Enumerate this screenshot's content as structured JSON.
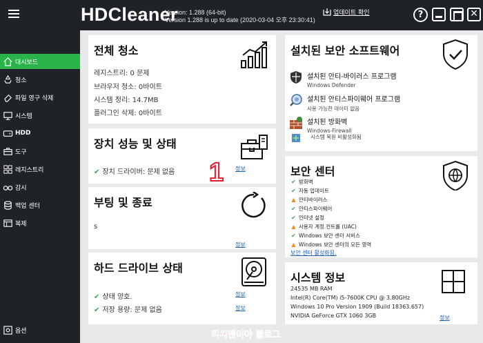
{
  "header": {
    "brand": "HDCleaner",
    "version_line1": "Version: 1.288 (64-bit)",
    "version_line2": "Version 1.288 is up to date (2020-03-04 오후 23:30:41)",
    "update_label": "업데이트 확인"
  },
  "sidebar": {
    "items": [
      {
        "label": "대시보드",
        "icon": "home-icon"
      },
      {
        "label": "청소",
        "icon": "recycle-icon"
      },
      {
        "label": "파일 영구 삭제",
        "icon": "eraser-icon"
      },
      {
        "label": "시스템",
        "icon": "monitor-icon"
      },
      {
        "label": "HDD",
        "icon": "hdd-icon"
      },
      {
        "label": "도구",
        "icon": "toolbox-icon"
      },
      {
        "label": "레지스트리",
        "icon": "registry-icon"
      },
      {
        "label": "감시",
        "icon": "glasses-icon"
      },
      {
        "label": "백업 센터",
        "icon": "database-icon"
      },
      {
        "label": "복제",
        "icon": "clone-icon"
      }
    ],
    "settings_label": "옵션"
  },
  "panels": {
    "clean": {
      "title": "전체 청소",
      "lines": [
        "레지스트리: 0 문제",
        "브라우저 청소: 0바이트",
        "시스템 정리: 14.7MB",
        "플러그인 삭제: 0바이트"
      ]
    },
    "device": {
      "title": "장치 성능 및 상태",
      "line": "장치 드라이버: 문제 없음",
      "link": "정보"
    },
    "boot": {
      "title": "부팅 및 종료",
      "line": "s",
      "link": "정보"
    },
    "hdd": {
      "title": "하드 드라이브 상태",
      "lines": [
        "상태 양호.",
        "저장 용량: 문제 없음"
      ],
      "links": [
        "정보",
        "정보"
      ]
    },
    "security_sw": {
      "title": "설치된 보안 소프트웨어",
      "rows": [
        {
          "title": "설치된 안티-바이러스 프로그램",
          "sub": "Windows Defender"
        },
        {
          "title": "설치된 안티스파이웨어 프로그램",
          "sub": "사용 가능한 데이터 없음"
        },
        {
          "title": "설치된 방화벽",
          "sub": "Windows-Firewall"
        }
      ],
      "restore": "시스템 복원 비활성화됨"
    },
    "security_center": {
      "title": "보안 센터",
      "items": [
        {
          "label": "방화벽",
          "status": "ok"
        },
        {
          "label": "자동 업데이트",
          "status": "ok"
        },
        {
          "label": "안티바이러스",
          "status": "warn"
        },
        {
          "label": "안티스파이웨어",
          "status": "ok"
        },
        {
          "label": "인터넷 설정",
          "status": "ok"
        },
        {
          "label": "사용자 계정 컨트롤 (UAC)",
          "status": "warn"
        },
        {
          "label": "Windows 보안 센터 서비스",
          "status": "ok"
        },
        {
          "label": "Windows 보안 센터의 모든 영역",
          "status": "warn"
        }
      ],
      "activate_link": "보안 센터 활성화됨."
    },
    "system_info": {
      "title": "시스템 정보",
      "lines": [
        "24535 MB RAM",
        "Intel(R) Core(TM) i5-7600K CPU @ 3.80GHz",
        "Windows 10 Pro Version 1909 (Build 18363.657)",
        "NVIDIA GeForce GTX 1060 3GB"
      ],
      "link": "정보"
    }
  },
  "overlay": {
    "number": "1",
    "watermark": "피씨맨이야 블로그"
  },
  "colors": {
    "header_bg": "#1f2226",
    "active": "#29b34a",
    "check": "#2fa84f",
    "warn": "#f08a1d",
    "link": "#1a5fb4",
    "annotation": "#e0192e"
  }
}
